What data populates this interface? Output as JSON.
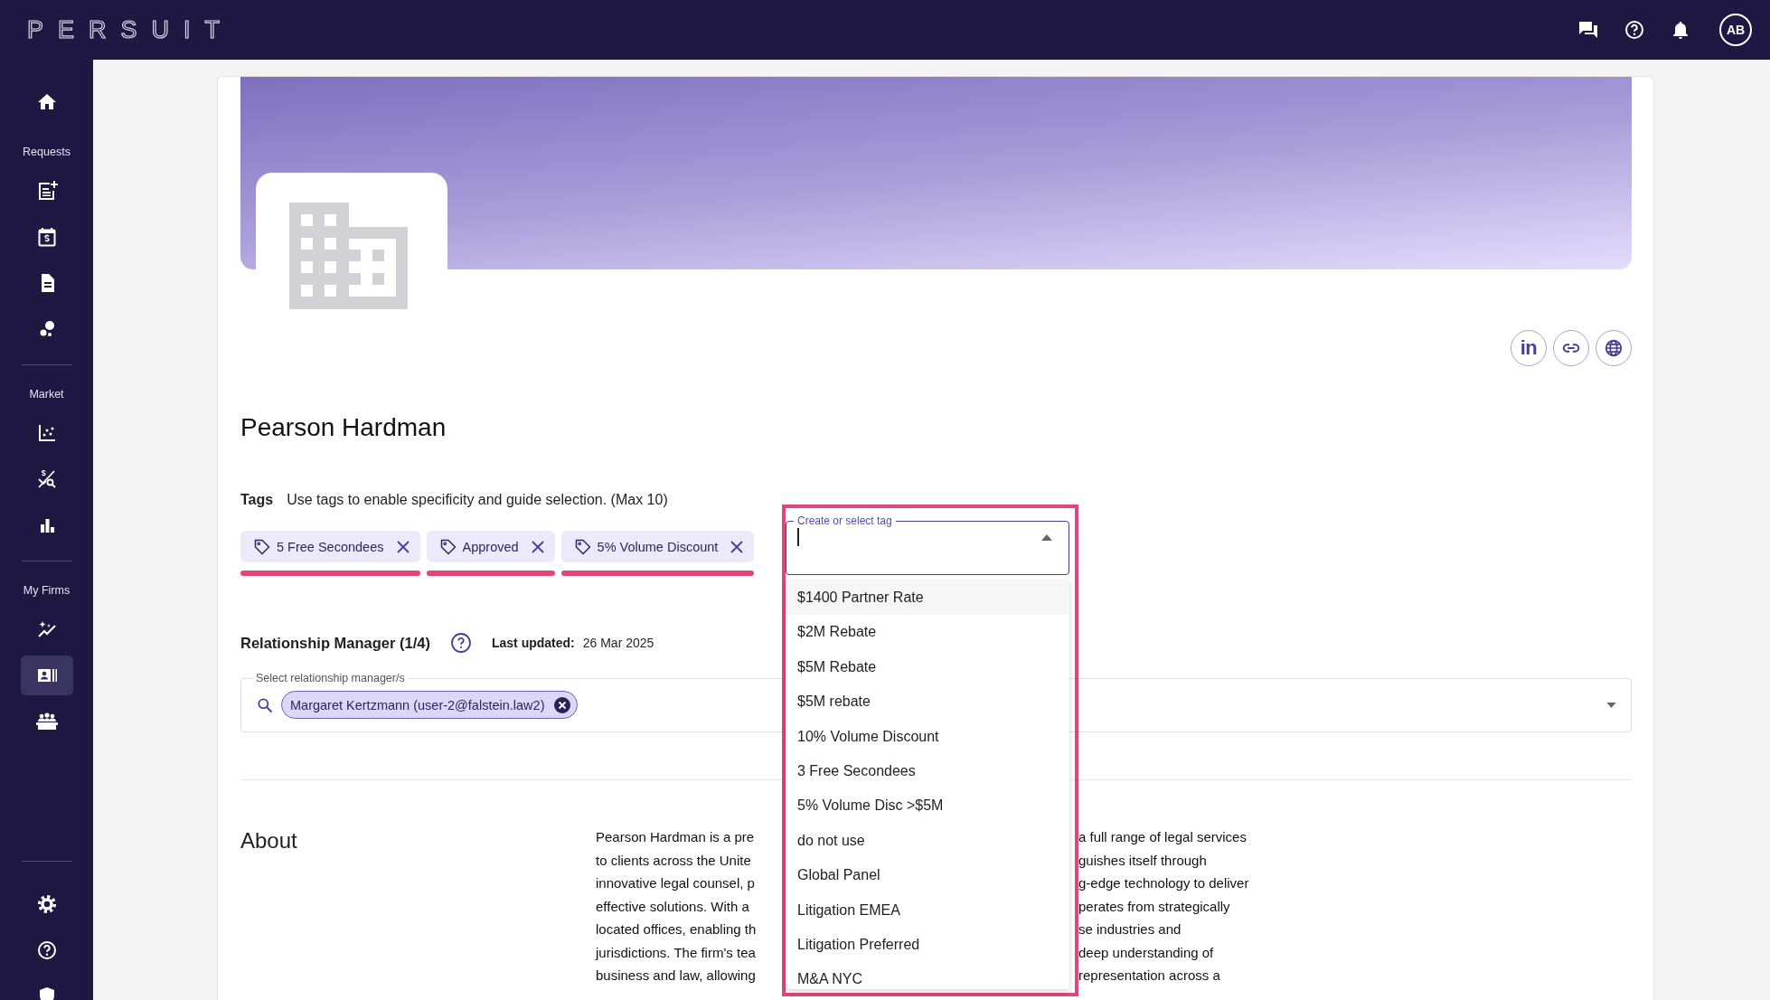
{
  "topbar": {
    "logo": "PERSUIT",
    "icons": [
      {
        "kind": "chat"
      },
      {
        "kind": "help"
      },
      {
        "kind": "bell"
      }
    ],
    "avatar": "AB"
  },
  "sidebar": {
    "groups": [
      {
        "items": [
          {
            "kind": "home",
            "selected": false
          }
        ]
      },
      {
        "label": "Requests",
        "items": [
          {
            "kind": "request-add",
            "selected": false
          },
          {
            "kind": "calendar-dollar",
            "selected": false
          },
          {
            "kind": "document",
            "selected": false
          },
          {
            "kind": "bubbles",
            "selected": false
          }
        ]
      },
      {
        "label": "Market",
        "items": [
          {
            "kind": "scatter",
            "selected": false
          },
          {
            "kind": "dollar-search",
            "selected": false
          },
          {
            "kind": "bar-chart",
            "selected": false
          }
        ]
      },
      {
        "label": "My Firms",
        "items": [
          {
            "kind": "sparkle-trend",
            "selected": false
          },
          {
            "kind": "id-card",
            "selected": true
          },
          {
            "kind": "team",
            "selected": false
          }
        ]
      }
    ],
    "footer_items": [
      {
        "kind": "settings",
        "selected": false
      },
      {
        "kind": "help",
        "selected": false
      },
      {
        "kind": "shield",
        "selected": false
      }
    ]
  },
  "profile": {
    "name": "Pearson Hardman",
    "social_links": [
      {
        "kind": "linkedin",
        "label": "in"
      },
      {
        "kind": "link"
      },
      {
        "kind": "globe"
      }
    ]
  },
  "tags": {
    "label": "Tags",
    "hint": "Use tags to enable specificity and guide selection. (Max 10)",
    "items": [
      {
        "label": "5 Free Secondees",
        "marked": true
      },
      {
        "label": "Approved",
        "marked": true
      },
      {
        "label": "5% Volume Discount",
        "marked": true
      }
    ],
    "picker": {
      "label": "Create or select tag",
      "marked": true,
      "expanded": true,
      "options": [
        {
          "label": "$1400 Partner Rate",
          "highlighted": true
        },
        {
          "label": "$2M Rebate",
          "highlighted": false
        },
        {
          "label": "$5M Rebate",
          "highlighted": false
        },
        {
          "label": "$5M rebate",
          "highlighted": false
        },
        {
          "label": "10% Volume Discount",
          "highlighted": false
        },
        {
          "label": "3 Free Secondees",
          "highlighted": false
        },
        {
          "label": "5% Volume Disc >$5M",
          "highlighted": false
        },
        {
          "label": "do not use",
          "highlighted": false
        },
        {
          "label": "Global Panel",
          "highlighted": false
        },
        {
          "label": "Litigation EMEA",
          "highlighted": false
        },
        {
          "label": "Litigation Preferred",
          "highlighted": false
        },
        {
          "label": "M&A NYC",
          "highlighted": false
        }
      ]
    }
  },
  "relationship": {
    "title": "Relationship Manager (1/4)",
    "updated_label": "Last updated:",
    "updated_value": "26 Mar 2025",
    "field": {
      "label": "Select relationship manager/s",
      "chips": [
        "Margaret Kertzmann (user-2@falstein.law2)"
      ]
    }
  },
  "about": {
    "title": "About",
    "lines": [
      {
        "left": "Pearson Hardman is a pre",
        "right": "a full range of legal services"
      },
      {
        "left": "to clients across the Unite",
        "right": "guishes itself through"
      },
      {
        "left": "innovative legal counsel, p",
        "right": "g-edge technology to deliver"
      },
      {
        "left": "effective solutions. With a",
        "right": "perates from strategically"
      },
      {
        "left": "located offices, enabling th",
        "right": "se industries and"
      },
      {
        "left": "jurisdictions. The firm's tea",
        "right": "deep understanding of"
      },
      {
        "left": "business and law, allowing",
        "right": "representation across a"
      }
    ]
  }
}
